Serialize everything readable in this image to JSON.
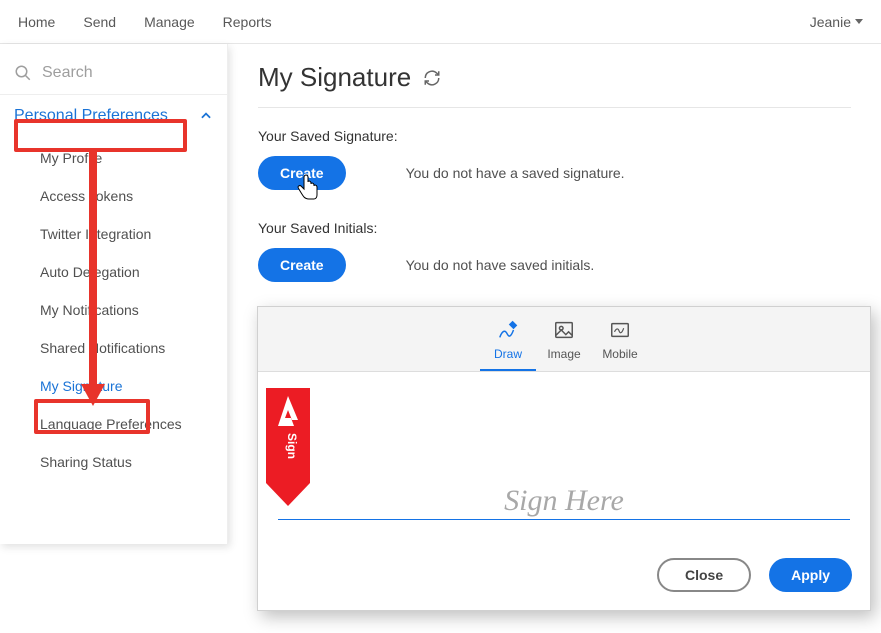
{
  "topnav": {
    "items": [
      "Home",
      "Send",
      "Manage",
      "Reports"
    ],
    "user": "Jeanie"
  },
  "sidebar": {
    "search_placeholder": "Search",
    "section_title": "Personal Preferences",
    "items": [
      {
        "label": "My Profile"
      },
      {
        "label": "Access Tokens"
      },
      {
        "label": "Twitter Integration"
      },
      {
        "label": "Auto Delegation"
      },
      {
        "label": "My Notifications"
      },
      {
        "label": "Shared Notifications"
      },
      {
        "label": "My Signature"
      },
      {
        "label": "Language Preferences"
      },
      {
        "label": "Sharing Status"
      }
    ]
  },
  "main": {
    "title": "My Signature",
    "signature": {
      "label": "Your Saved Signature:",
      "button": "Create",
      "status": "You do not have a saved signature."
    },
    "initials": {
      "label": "Your Saved Initials:",
      "button": "Create",
      "status": "You do not have saved initials."
    }
  },
  "dialog": {
    "tabs": {
      "draw": "Draw",
      "image": "Image",
      "mobile": "Mobile"
    },
    "placeholder": "Sign Here",
    "tab_badge": "Sign",
    "close": "Close",
    "apply": "Apply"
  }
}
